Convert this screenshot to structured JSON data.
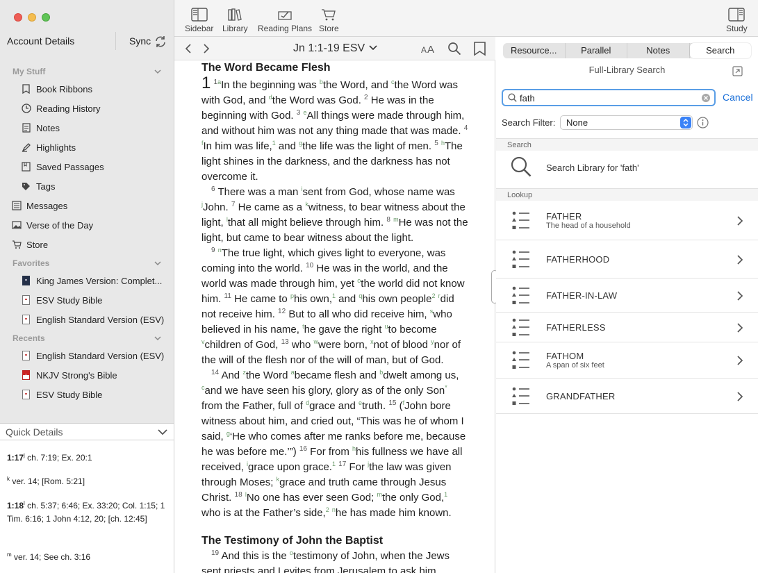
{
  "sidebar": {
    "account": "Account Details",
    "sync": "Sync",
    "my_stuff": "My Stuff",
    "my_stuff_items": [
      "Book Ribbons",
      "Reading History",
      "Notes",
      "Highlights",
      "Saved Passages",
      "Tags"
    ],
    "top_items": [
      "Messages",
      "Verse of the Day",
      "Store"
    ],
    "favorites": "Favorites",
    "favorite_items": [
      "King James Version: Complet...",
      "ESV Study Bible",
      "English Standard Version (ESV)"
    ],
    "recents": "Recents",
    "recent_items": [
      "English Standard Version (ESV)",
      "NKJV Strong's Bible",
      "ESV Study Bible"
    ]
  },
  "quick_details": {
    "title": "Quick Details",
    "notes": [
      {
        "ref": "1:17",
        "mark": "j",
        "text": "ch. 7:19; Ex. 20:1"
      },
      {
        "ref": "",
        "mark": "k",
        "text": "ver. 14; [Rom. 5:21]"
      },
      {
        "ref": "1:18",
        "mark": "l",
        "text": "ch. 5:37; 6:46; Ex. 33:20; Col. 1:15; 1 Tim. 6:16; 1 John 4:12, 20; [ch. 12:45]"
      },
      {
        "ref": "",
        "mark": "m",
        "text": "ver. 14; See ch. 3:16"
      }
    ]
  },
  "toolbar": {
    "sidebar": "Sidebar",
    "library": "Library",
    "reading_plans": "Reading Plans",
    "store": "Store",
    "study": "Study"
  },
  "reader": {
    "passage": "Jn 1:1-19 ESV",
    "heading1": "The Word Became Flesh",
    "heading2": "The Testimony of John the Baptist"
  },
  "panel": {
    "tabs": [
      "Resource...",
      "Parallel",
      "Notes",
      "Search"
    ],
    "active_tab": "Search",
    "title": "Full-Library Search",
    "query": "fath",
    "cancel": "Cancel",
    "filter_label": "Search Filter:",
    "filter_value": "None",
    "search_group": "Search",
    "search_action": "Search Library for 'fath'",
    "lookup_group": "Lookup",
    "lookups": [
      {
        "title": "FATHER",
        "sub": "The head of a household"
      },
      {
        "title": "FATHERHOOD",
        "sub": ""
      },
      {
        "title": "FATHER-IN-LAW",
        "sub": ""
      },
      {
        "title": "FATHERLESS",
        "sub": ""
      },
      {
        "title": "FATHOM",
        "sub": "A span of six feet"
      },
      {
        "title": "GRANDFATHER",
        "sub": ""
      }
    ]
  }
}
